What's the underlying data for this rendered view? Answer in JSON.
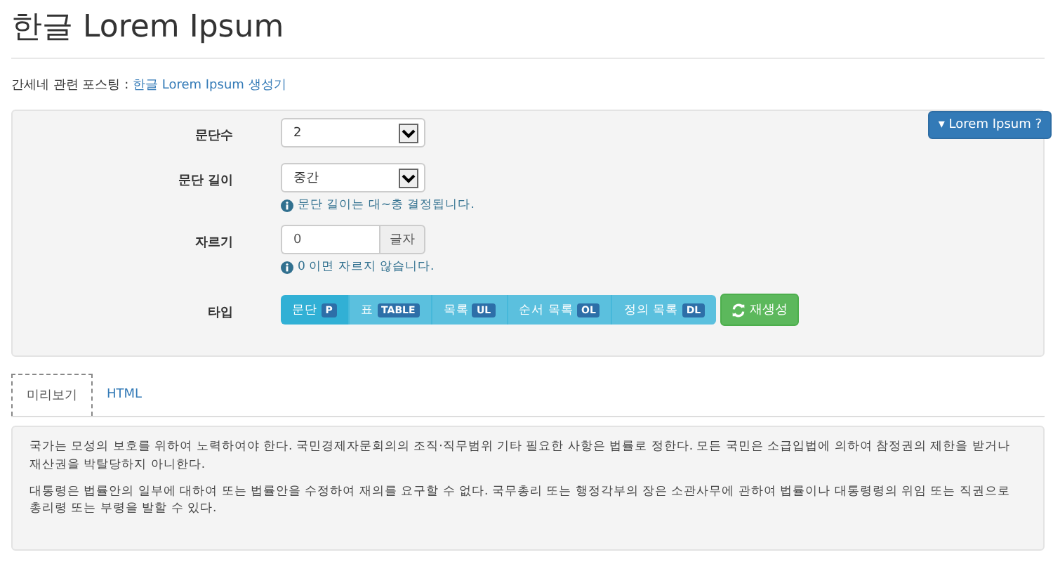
{
  "page_title": "한글 Lorem Ipsum",
  "related": {
    "label": "간세네 관련 포스팅 :",
    "link": "한글 Lorem Ipsum 생성기"
  },
  "help_button": {
    "caret": "▾",
    "label": "Lorem Ipsum ?"
  },
  "form": {
    "paragraph_count": {
      "label": "문단수",
      "value": "2"
    },
    "paragraph_length": {
      "label": "문단 길이",
      "value": "중간",
      "help": "문단 길이는 대~충 결정됩니다."
    },
    "truncate": {
      "label": "자르기",
      "value": "0",
      "addon": "글자",
      "help": "0 이면 자르지 않습니다."
    },
    "type": {
      "label": "타입",
      "options": [
        {
          "label": "문단",
          "badge": "P",
          "selected": true
        },
        {
          "label": "표",
          "badge": "TABLE",
          "selected": false
        },
        {
          "label": "목록",
          "badge": "UL",
          "selected": false
        },
        {
          "label": "순서 목록",
          "badge": "OL",
          "selected": false
        },
        {
          "label": "정의 목록",
          "badge": "DL",
          "selected": false
        }
      ]
    },
    "regenerate": "재생성"
  },
  "tabs": [
    {
      "label": "미리보기",
      "selected": true
    },
    {
      "label": "HTML",
      "selected": false
    }
  ],
  "preview": [
    "국가는 모성의 보호를 위하여 노력하여야 한다. 국민경제자문회의의 조직·직무범위 기타 필요한 사항은 법률로 정한다. 모든 국민은 소급입법에 의하여 참정권의 제한을 받거나 재산권을 박탈당하지 아니한다.",
    "대통령은 법률안의 일부에 대하여 또는 법률안을 수정하여 재의를 요구할 수 없다. 국무총리 또는 행정각부의 장은 소관사무에 관하여 법률이나 대통령령의 위임 또는 직권으로 총리령 또는 부령을 발할 수 있다."
  ]
}
